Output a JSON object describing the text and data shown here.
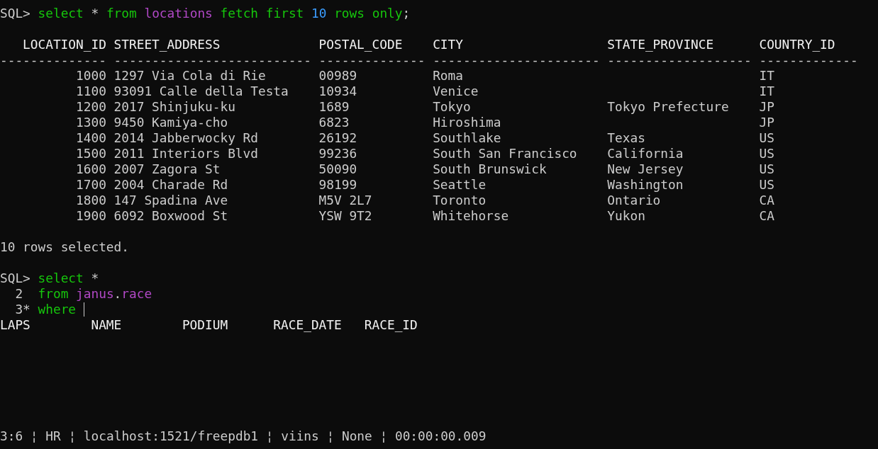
{
  "first_query": {
    "lines": [
      {
        "kind": "sql",
        "prompt": "SQL>",
        "tokens": [
          {
            "kind": "keyword",
            "text": "select"
          },
          {
            "kind": "operator",
            "text": "*"
          },
          {
            "kind": "keyword",
            "text": "from"
          },
          {
            "kind": "identifier",
            "text": "locations"
          },
          {
            "kind": "keyword",
            "text": "fetch first"
          },
          {
            "kind": "number",
            "text": "10"
          },
          {
            "kind": "keyword",
            "text": "rows only"
          },
          {
            "kind": "punct",
            "text": ";"
          }
        ]
      }
    ]
  },
  "result_table": {
    "columns": [
      {
        "name": "LOCATION_ID",
        "rule": "--------------",
        "kind": "number"
      },
      {
        "name": "STREET_ADDRESS",
        "rule": "--------------------------",
        "kind": "text"
      },
      {
        "name": "POSTAL_CODE",
        "rule": "--------------",
        "kind": "text"
      },
      {
        "name": "CITY",
        "rule": "----------------------",
        "kind": "text"
      },
      {
        "name": "STATE_PROVINCE",
        "rule": "-------------------",
        "kind": "text"
      },
      {
        "name": "COUNTRY_ID",
        "rule": "-------------",
        "kind": "text"
      }
    ],
    "rows": [
      [
        "1000",
        "1297 Via Cola di Rie",
        "00989",
        "Roma",
        null,
        "IT"
      ],
      [
        "1100",
        "93091 Calle della Testa",
        "10934",
        "Venice",
        null,
        "IT"
      ],
      [
        "1200",
        "2017 Shinjuku-ku",
        "1689",
        "Tokyo",
        "Tokyo Prefecture",
        "JP"
      ],
      [
        "1300",
        "9450 Kamiya-cho",
        "6823",
        "Hiroshima",
        null,
        "JP"
      ],
      [
        "1400",
        "2014 Jabberwocky Rd",
        "26192",
        "Southlake",
        "Texas",
        "US"
      ],
      [
        "1500",
        "2011 Interiors Blvd",
        "99236",
        "South San Francisco",
        "California",
        "US"
      ],
      [
        "1600",
        "2007 Zagora St",
        "50090",
        "South Brunswick",
        "New Jersey",
        "US"
      ],
      [
        "1700",
        "2004 Charade Rd",
        "98199",
        "Seattle",
        "Washington",
        "US"
      ],
      [
        "1800",
        "147 Spadina Ave",
        "M5V 2L7",
        "Toronto",
        "Ontario",
        "CA"
      ],
      [
        "1900",
        "6092 Boxwood St",
        "YSW 9T2",
        "Whitehorse",
        "Yukon",
        "CA"
      ]
    ],
    "footer": "10 rows selected."
  },
  "second_query": {
    "lines": [
      {
        "kind": "sql",
        "prompt": "SQL>",
        "tokens": [
          {
            "kind": "keyword",
            "text": "select"
          },
          {
            "kind": "operator",
            "text": "*"
          }
        ]
      },
      {
        "kind": "continuation",
        "prompt": "2",
        "tokens": [
          {
            "kind": "keyword",
            "text": "from"
          },
          {
            "kind": "identifier",
            "text": "janus"
          },
          {
            "kind": "punct",
            "text": "."
          },
          {
            "kind": "identifier",
            "text": "race"
          }
        ]
      },
      {
        "kind": "continuation",
        "prompt": "3*",
        "cursor": true,
        "tokens": [
          {
            "kind": "keyword",
            "text": "where"
          }
        ]
      }
    ]
  },
  "completion_columns": [
    "LAPS",
    "NAME",
    "PODIUM",
    "RACE_DATE",
    "RACE_ID"
  ],
  "status_bar": [
    "3:6",
    "HR",
    "localhost:1521/freepdb1",
    "viins",
    "None",
    "00:00:00.009"
  ],
  "status_separator": "¦"
}
